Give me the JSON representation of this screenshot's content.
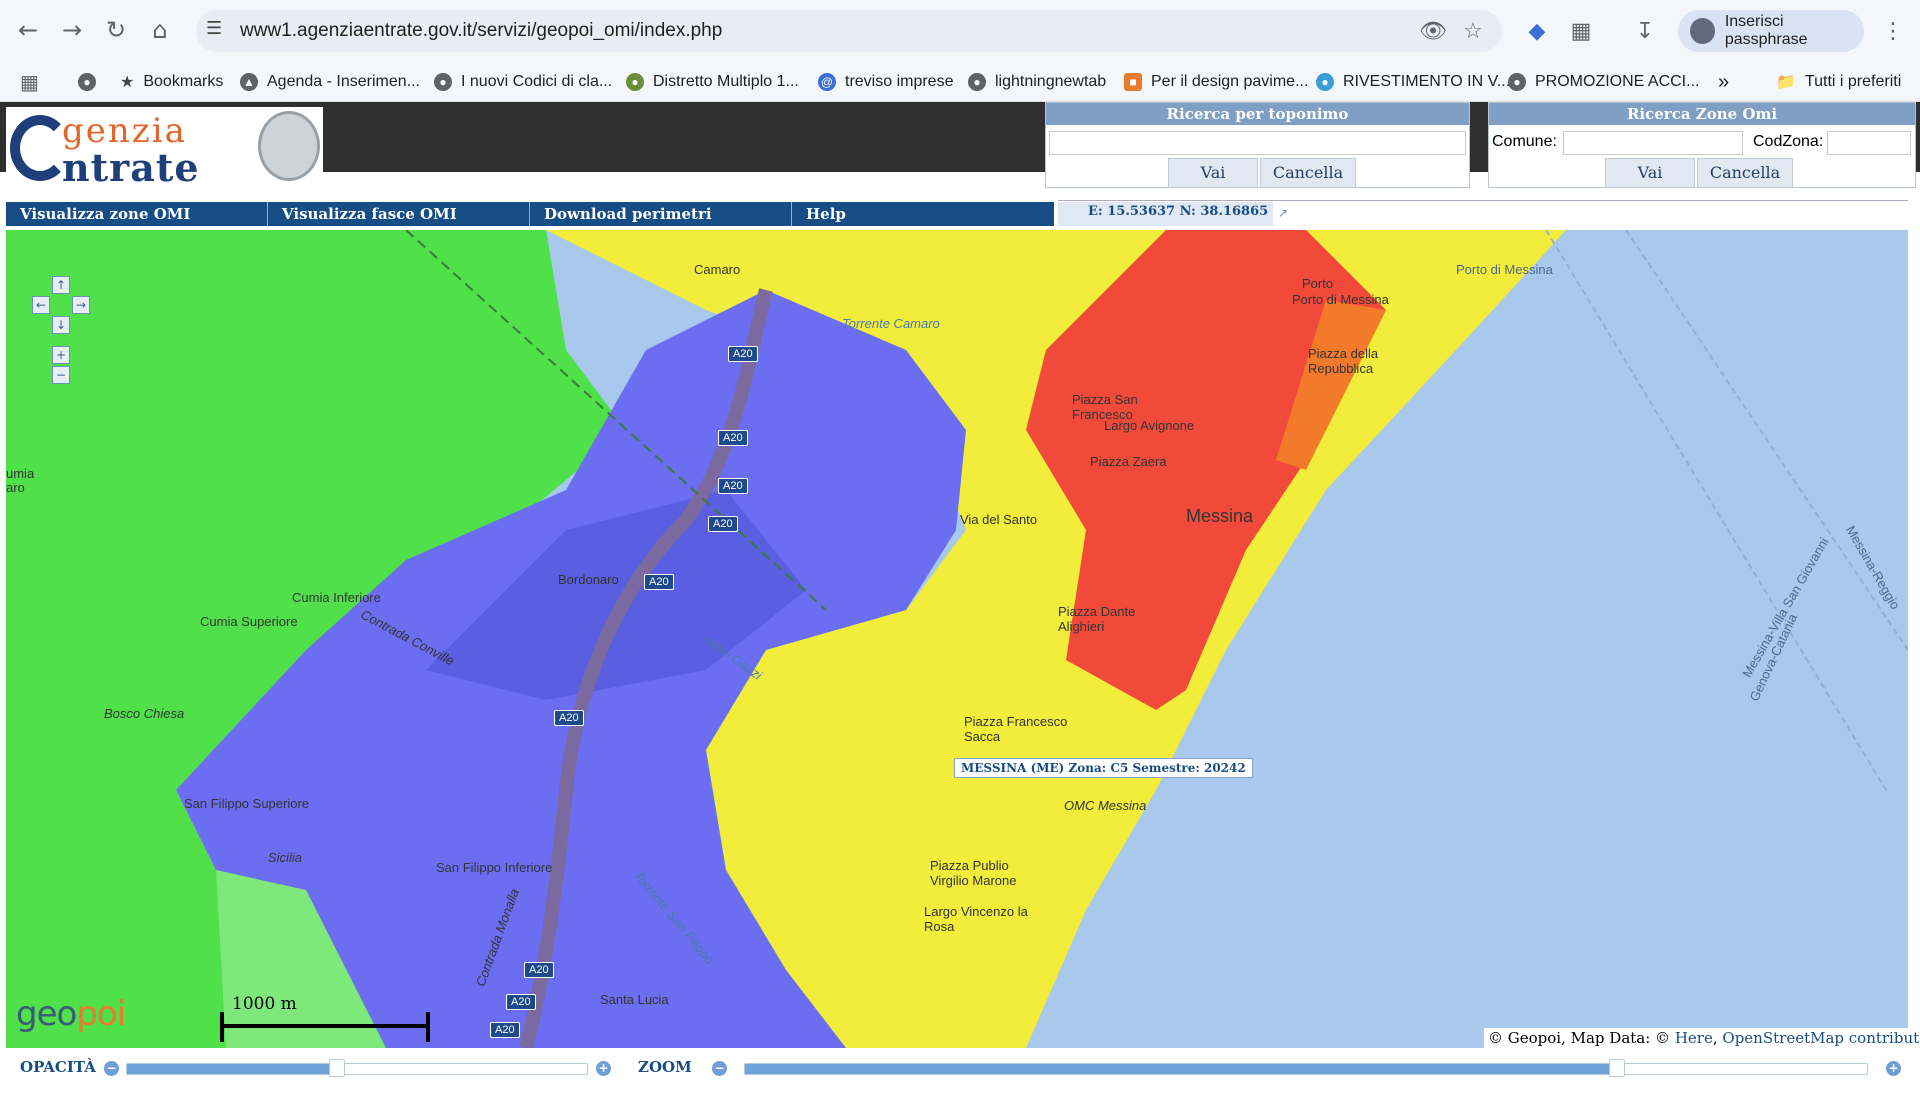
{
  "browser": {
    "url": "www1.agenziaentrate.gov.it/servizi/geopoi_omi/index.php",
    "passphrase_button": "Inserisci passphrase",
    "bookmarks": [
      "Bookmarks",
      "Agenda - Inserimen...",
      "I nuovi Codici di cla...",
      "Distretto Multiplo 1...",
      "treviso imprese",
      "lightningnewtab",
      "Per il design pavime...",
      "RIVESTIMENTO IN V...",
      "PROMOZIONE ACCI..."
    ],
    "all_bookmarks": "Tutti i preferiti"
  },
  "logo": {
    "line1": "genzia",
    "line2": "ntrate"
  },
  "search_toponym": {
    "title": "Ricerca per toponimo",
    "value": "",
    "go": "Vai",
    "clear": "Cancella"
  },
  "search_zones": {
    "title": "Ricerca Zone Omi",
    "comune_label": "Comune:",
    "comune_value": "",
    "codzona_label": "CodZona:",
    "codzona_value": "",
    "go": "Vai",
    "clear": "Cancella"
  },
  "menu": {
    "items": [
      "Visualizza zone OMI",
      "Visualizza fasce OMI",
      "Download perimetri",
      "Help"
    ]
  },
  "coords": "E: 15.53637  N: 38.16865",
  "map": {
    "labels": {
      "camaro": "Camaro",
      "torrente_camaro": "Torrente Camaro",
      "porto": "Porto",
      "porto_di_messina": "Porto di Messina",
      "porto_di_messina_sea": "Porto di Messina",
      "piazza_repubblica": "Piazza della Repubblica",
      "piazza_san_francesco": "Piazza San Francesco",
      "largo_avignone": "Largo Avignone",
      "piazza_zaera": "Piazza Zaera",
      "messina": "Messina",
      "via_del_santo": "Via del Santo",
      "piazza_dante": "Piazza Dante Alighieri",
      "cumia_inferiore": "Cumia Inferiore",
      "cumia_superiore": "Cumia Superiore",
      "bordonaro": "Bordonaro",
      "contrada_conville": "Contrada Conville",
      "bosco_chiesa": "Bosco Chiesa",
      "san_filippo_superiore": "San Filippo Superiore",
      "sicilia": "Sicilia",
      "san_filippo_inferiore": "San Filippo Inferiore",
      "contrada_monalla": "Contrada Monalla",
      "torrente_san_filippo": "Torrente San Filippo",
      "santa_lucia": "Santa Lucia",
      "piazza_francesco_sacca": "Piazza Francesco Sacca",
      "omc_messina": "OMC Messina",
      "piazza_publio": "Piazza Publio Virgilio Marone",
      "largo_vincenzo": "Largo Vincenzo la Rosa",
      "cumia": "umia",
      "cumia2": "aro",
      "ferry1": "Messina-Villa San Giovanni",
      "ferry2": "Messina-Reggio",
      "ferry3": "Genova-Catania",
      "torrente_gazzi": "rente Gazzi"
    },
    "road_label": "A20",
    "tooltip": "MESSINA (ME) Zona: C5 Semestre: 20242",
    "scale": "1000 m",
    "attribution_prefix": "© Geopoi, Map Data: ©",
    "attribution_here": "Here",
    "attribution_osm": "OpenStreetMap contributors",
    "zone_colors": {
      "green": "#4fe04a",
      "blue": "#6b6ef0",
      "yellow": "#f2ec3a",
      "red": "#f24a3a",
      "sea": "#a8c8ec"
    }
  },
  "controls": {
    "opacity_label": "OPACITÀ",
    "zoom_label": "ZOOM",
    "opacity_level": 0.44,
    "zoom_level": 0.77
  }
}
